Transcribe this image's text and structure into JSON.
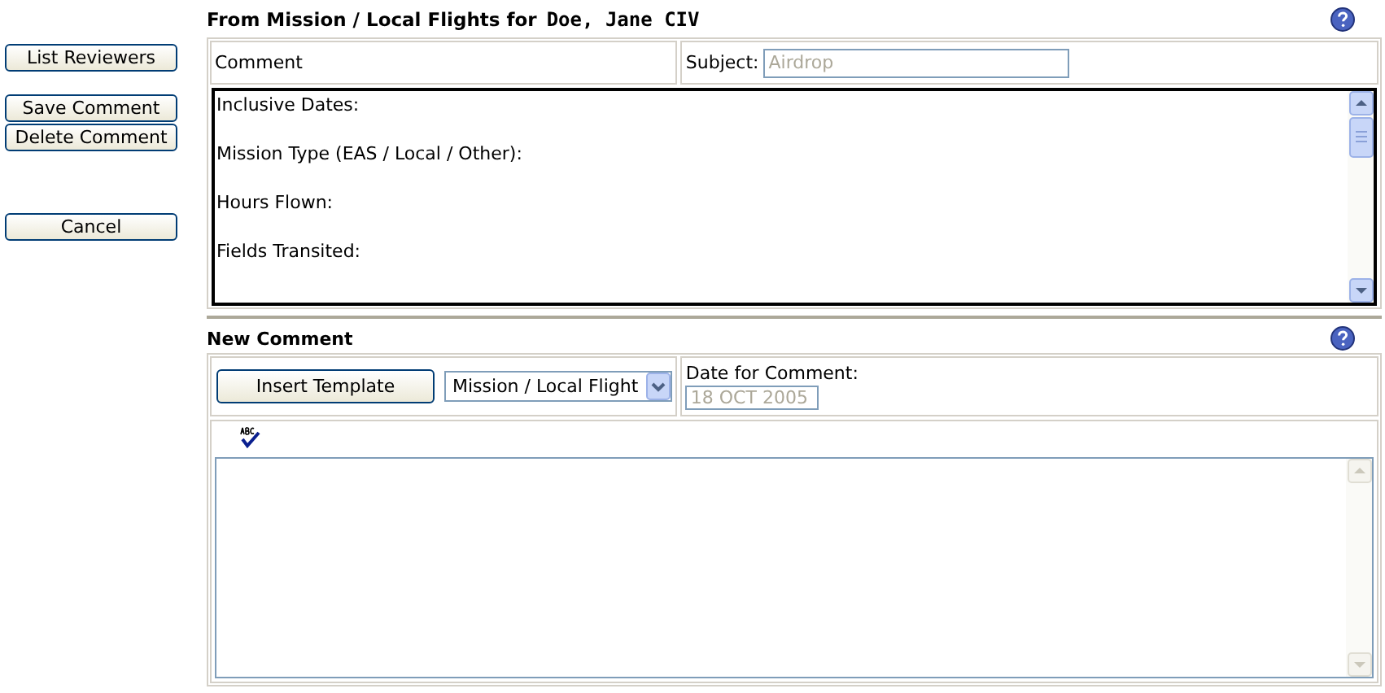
{
  "title": {
    "prefix": "From Mission / Local Flights for",
    "name": "Doe, Jane CIV"
  },
  "side_buttons": [
    {
      "label": "List Reviewers"
    },
    {
      "label": "Save Comment"
    },
    {
      "label": "Delete Comment"
    },
    {
      "label": "Cancel"
    }
  ],
  "comment": {
    "label": "Comment",
    "subject_label": "Subject:",
    "subject_value": "Airdrop",
    "lines": [
      "Inclusive Dates:",
      "Mission Type (EAS / Local / Other):",
      "Hours Flown:",
      "Fields Transited:"
    ]
  },
  "new_comment": {
    "heading": "New Comment",
    "insert_button": "Insert Template",
    "template_value": "Mission / Local Flight",
    "date_label": "Date for Comment:",
    "date_value": "18 OCT 2005"
  }
}
